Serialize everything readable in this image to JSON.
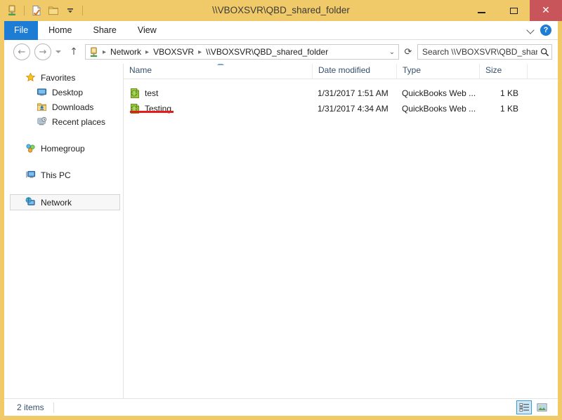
{
  "window": {
    "title": "\\\\VBOXSVR\\QBD_shared_folder",
    "accent_titlebar": "#f0c968",
    "close_button_color": "#c8555a"
  },
  "quick_access": {
    "items": [
      {
        "name": "network-folder-icon",
        "label": "Network folder"
      },
      {
        "name": "properties-icon",
        "label": "Properties"
      },
      {
        "name": "new-folder-icon",
        "label": "New folder"
      },
      {
        "name": "customize-chevron-icon",
        "label": "Customize Quick Access Toolbar"
      }
    ]
  },
  "window_controls": {
    "minimize": "Minimize",
    "maximize": "Maximize",
    "close": "✕"
  },
  "ribbon": {
    "tabs": [
      {
        "label": "File",
        "selected": true
      },
      {
        "label": "Home",
        "selected": false
      },
      {
        "label": "Share",
        "selected": false
      },
      {
        "label": "View",
        "selected": false
      }
    ],
    "expand_label": "Expand the Ribbon",
    "help_label": "?"
  },
  "navigation": {
    "back": "←",
    "forward": "→",
    "recent_dropdown": "Recent locations",
    "up": "↑"
  },
  "breadcrumb": {
    "icon": "network-folder-icon",
    "parts": [
      "Network",
      "VBOXSVR",
      "\\\\VBOXSVR\\QBD_shared_folder"
    ],
    "separator": "▸",
    "dropdown": "⌄",
    "refresh": "⟳"
  },
  "search": {
    "placeholder": "Search \\\\VBOXSVR\\QBD_shar...",
    "value": "",
    "icon": "search-icon"
  },
  "sidebar": {
    "groups": [
      {
        "header": {
          "label": "Favorites",
          "icon": "star-icon"
        },
        "items": [
          {
            "label": "Desktop",
            "icon": "desktop-icon"
          },
          {
            "label": "Downloads",
            "icon": "downloads-icon"
          },
          {
            "label": "Recent places",
            "icon": "recent-places-icon"
          }
        ]
      },
      {
        "header": {
          "label": "Homegroup",
          "icon": "homegroup-icon"
        },
        "items": []
      },
      {
        "header": {
          "label": "This PC",
          "icon": "this-pc-icon"
        },
        "items": []
      },
      {
        "header": {
          "label": "Network",
          "icon": "network-icon",
          "selected": true
        },
        "items": []
      }
    ]
  },
  "file_list": {
    "columns": [
      {
        "key": "name",
        "label": "Name",
        "sorted": "asc"
      },
      {
        "key": "date_modified",
        "label": "Date modified"
      },
      {
        "key": "type",
        "label": "Type"
      },
      {
        "key": "size",
        "label": "Size"
      }
    ],
    "rows": [
      {
        "name": "test",
        "date_modified": "1/31/2017 1:51 AM",
        "type": "QuickBooks Web ...",
        "size": "1 KB",
        "icon": "quickbooks-file-icon"
      },
      {
        "name": "Testing",
        "date_modified": "1/31/2017 4:34 AM",
        "type": "QuickBooks Web ...",
        "size": "1 KB",
        "icon": "quickbooks-file-icon",
        "annotated": true
      }
    ]
  },
  "annotation": {
    "color": "#e81b1b",
    "target": "Testing"
  },
  "status_bar": {
    "item_count": "2 items",
    "views": [
      {
        "name": "details-view-button",
        "label": "Details view",
        "active": true
      },
      {
        "name": "large-icons-view-button",
        "label": "Large icons view",
        "active": false
      }
    ]
  }
}
